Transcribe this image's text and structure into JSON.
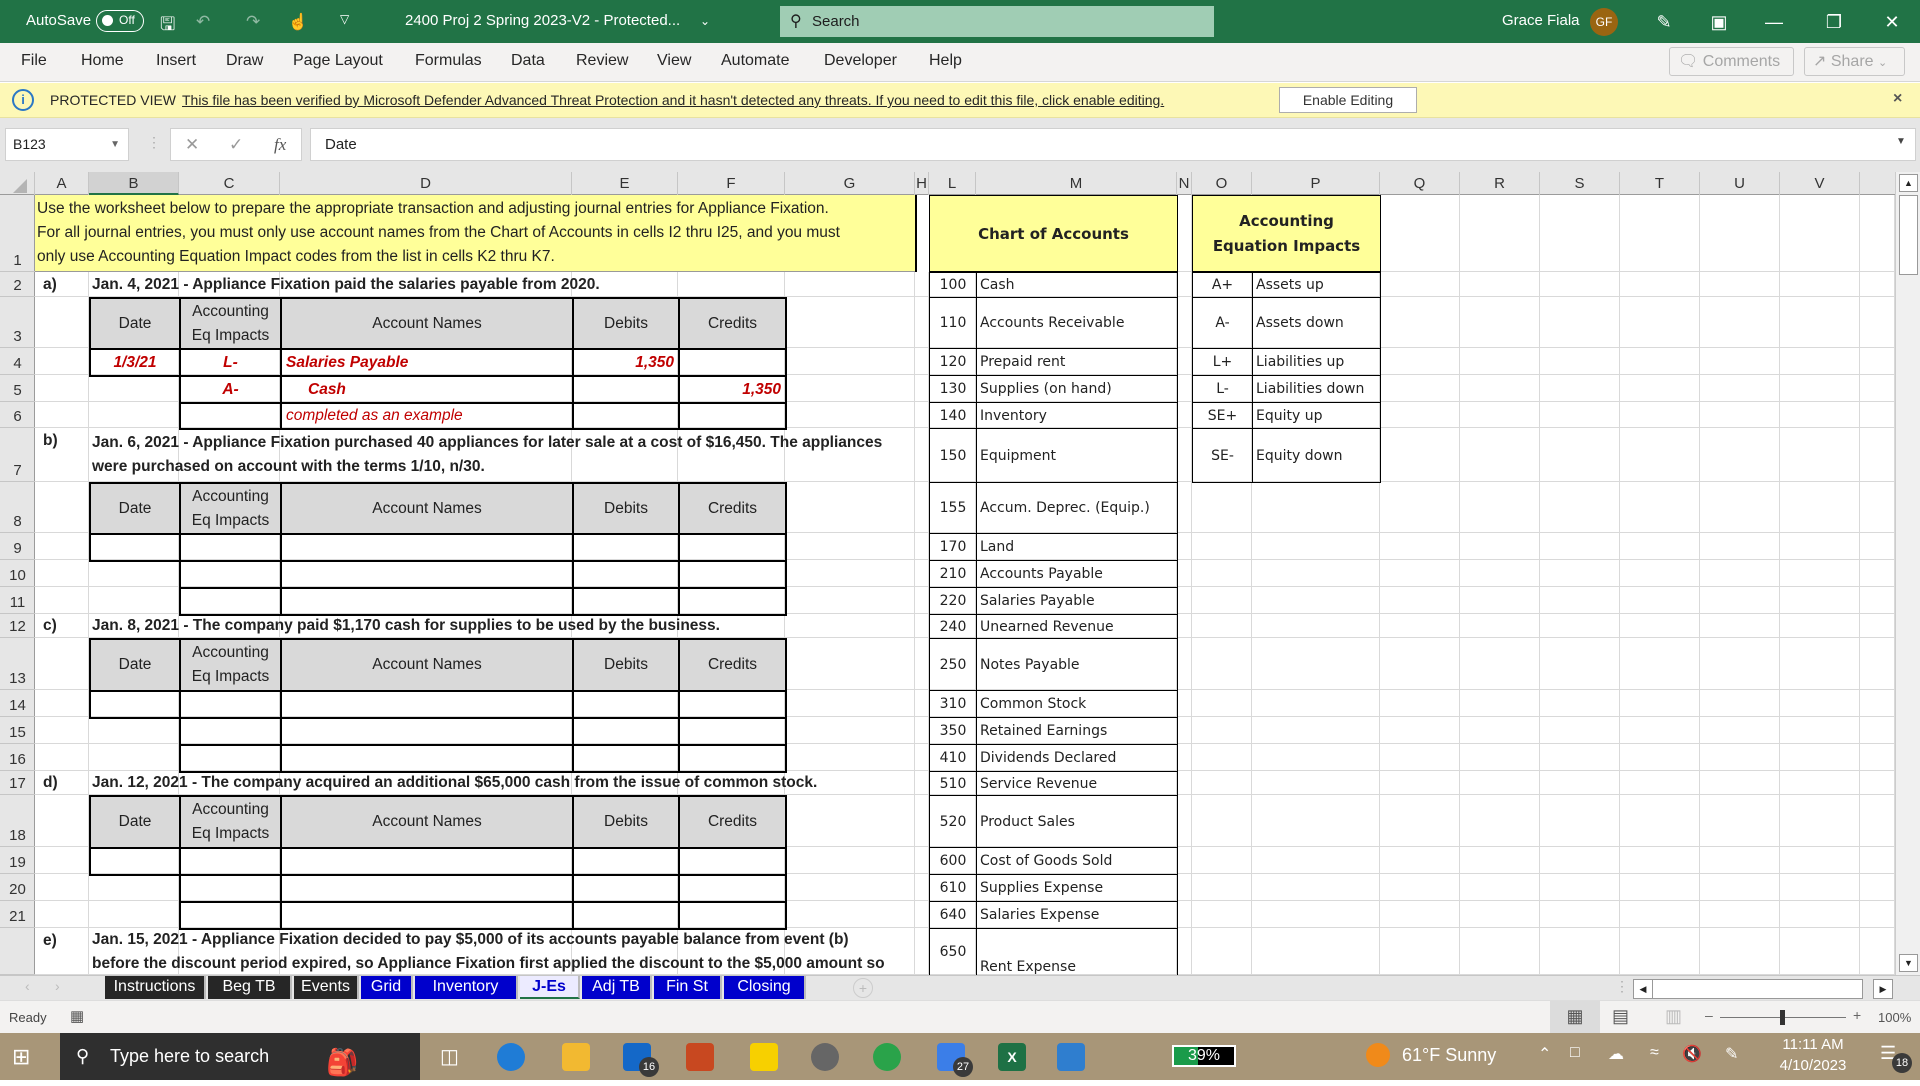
{
  "titlebar": {
    "autosave_label": "AutoSave",
    "autosave_state": "Off",
    "doc_title": "2400 Proj 2 Spring 2023-V2  -  Protected...",
    "search_placeholder": "Search",
    "user_name": "Grace Fiala",
    "user_initials": "GF"
  },
  "ribbon": {
    "tabs": [
      "File",
      "Home",
      "Insert",
      "Draw",
      "Page Layout",
      "Formulas",
      "Data",
      "Review",
      "View",
      "Automate",
      "Developer",
      "Help"
    ],
    "comments_label": "Comments",
    "share_label": "Share"
  },
  "protected_view": {
    "label": "PROTECTED VIEW",
    "message": "This file has been verified by Microsoft Defender Advanced Threat Protection and it hasn't detected any threats. If you need to edit this file, click enable editing.",
    "enable_button": "Enable Editing"
  },
  "formula_bar": {
    "name_box": "B123",
    "fx_label": "fx",
    "formula": "Date"
  },
  "columns": [
    "A",
    "B",
    "C",
    "D",
    "E",
    "F",
    "G",
    "H",
    "L",
    "M",
    "N",
    "O",
    "P",
    "Q",
    "R",
    "S",
    "T",
    "U",
    "V"
  ],
  "rows": [
    "1",
    "2",
    "3",
    "4",
    "5",
    "6",
    "7",
    "8",
    "9",
    "10",
    "11",
    "12",
    "13",
    "14",
    "15",
    "16",
    "17",
    "18",
    "19",
    "20",
    "21",
    ""
  ],
  "instructions": [
    "Use the worksheet below to prepare the appropriate transaction and adjusting journal entries for Appliance Fixation.",
    "For all journal entries, you must only use account names from the Chart of Accounts in cells I2 thru I25, and you must",
    "only use Accounting Equation Impact codes from the list in cells K2 thru K7."
  ],
  "journal_header": {
    "date": "Date",
    "impacts": "Accounting Eq Impacts",
    "accounts": "Account Names",
    "debits": "Debits",
    "credits": "Credits"
  },
  "events": [
    {
      "letter": "a)",
      "text": [
        "Jan. 4, 2021 - Appliance Fixation paid the salaries payable from 2020."
      ],
      "entries": [
        {
          "date": "1/3/21",
          "impact": "L-",
          "account": "Salaries Payable",
          "debit": "1,350",
          "credit": ""
        },
        {
          "date": "",
          "impact": "A-",
          "account": "Cash",
          "debit": "",
          "credit": "1,350"
        },
        {
          "date": "",
          "impact": "",
          "account": "completed as an example",
          "debit": "",
          "credit": ""
        }
      ]
    },
    {
      "letter": "b)",
      "text": [
        "Jan. 6, 2021 - Appliance Fixation purchased 40 appliances for later sale at a cost of $16,450. The appliances",
        "were purchased on account with the terms 1/10, n/30."
      ]
    },
    {
      "letter": "c)",
      "text": [
        "Jan. 8, 2021 - The company paid $1,170 cash for supplies to be used by the business."
      ]
    },
    {
      "letter": "d)",
      "text": [
        "Jan. 12, 2021 - The company acquired an additional $65,000 cash from the issue of common stock."
      ]
    },
    {
      "letter": "e)",
      "text": [
        "Jan. 15, 2021 - Appliance Fixation decided to pay $5,000 of its accounts payable balance from event (b)",
        "before the discount period expired, so Appliance Fixation first applied the discount to the $5,000 amount so"
      ]
    }
  ],
  "chart_of_accounts": {
    "title": "Chart of Accounts",
    "items": [
      {
        "num": "100",
        "name": "Cash"
      },
      {
        "num": "110",
        "name": "Accounts Receivable"
      },
      {
        "num": "120",
        "name": "Prepaid rent"
      },
      {
        "num": "130",
        "name": "Supplies (on hand)"
      },
      {
        "num": "140",
        "name": "Inventory"
      },
      {
        "num": "150",
        "name": "Equipment"
      },
      {
        "num": "155",
        "name": "Accum. Deprec. (Equip.)"
      },
      {
        "num": "170",
        "name": "Land"
      },
      {
        "num": "210",
        "name": "Accounts Payable"
      },
      {
        "num": "220",
        "name": "Salaries Payable"
      },
      {
        "num": "240",
        "name": "Unearned Revenue"
      },
      {
        "num": "250",
        "name": "Notes Payable"
      },
      {
        "num": "310",
        "name": "Common Stock"
      },
      {
        "num": "350",
        "name": "Retained Earnings"
      },
      {
        "num": "410",
        "name": "Dividends Declared"
      },
      {
        "num": "510",
        "name": "Service Revenue"
      },
      {
        "num": "520",
        "name": "Product Sales"
      },
      {
        "num": "600",
        "name": "Cost of Goods Sold"
      },
      {
        "num": "610",
        "name": "Supplies Expense"
      },
      {
        "num": "640",
        "name": "Salaries Expense"
      },
      {
        "num": "650",
        "name": "Rent Expense"
      }
    ]
  },
  "equation_impacts": {
    "title_line1": "Accounting",
    "title_line2": "Equation Impacts",
    "items": [
      {
        "code": "A+",
        "desc": "Assets up"
      },
      {
        "code": "A-",
        "desc": "Assets down"
      },
      {
        "code": "L+",
        "desc": "Liabilities up"
      },
      {
        "code": "L-",
        "desc": "Liabilities down"
      },
      {
        "code": "SE+",
        "desc": "Equity up"
      },
      {
        "code": "SE-",
        "desc": "Equity down"
      }
    ]
  },
  "sheet_tabs": [
    {
      "label": "Instructions",
      "color": "#262626"
    },
    {
      "label": "Beg TB",
      "color": "#262626"
    },
    {
      "label": "Events",
      "color": "#262626"
    },
    {
      "label": "Grid",
      "color": "#0000cc"
    },
    {
      "label": "Inventory",
      "color": "#0000cc"
    },
    {
      "label": "J-Es",
      "color": "#ffffff",
      "active": true
    },
    {
      "label": "Adj TB",
      "color": "#0000cc"
    },
    {
      "label": "Fin St",
      "color": "#0000cc"
    },
    {
      "label": "Closing",
      "color": "#0000cc"
    }
  ],
  "status": {
    "mode": "Ready",
    "zoom": "100%"
  },
  "taskbar": {
    "search_placeholder": "Type here to search",
    "mail_badge": "16",
    "todo_badge": "27",
    "battery": "39%",
    "weather": "61°F  Sunny",
    "time": "11:11 AM",
    "date": "4/10/2023",
    "notifications": "18"
  }
}
